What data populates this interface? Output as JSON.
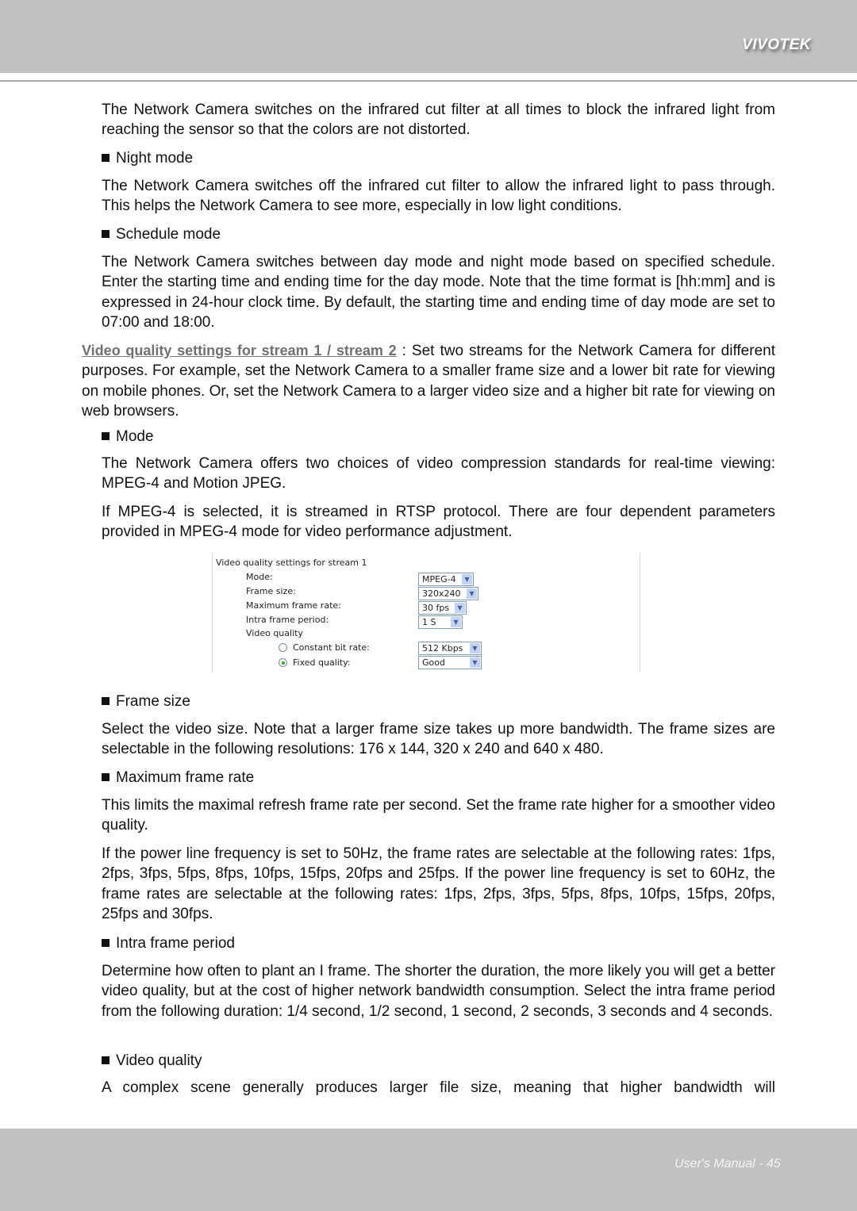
{
  "header": {
    "brand": "VIVOTEK"
  },
  "footer": {
    "page_label": "User's Manual - 45"
  },
  "content": {
    "p1": "The Network Camera switches on the infrared cut filter at all times to block the infrared light from reaching the sensor so that the colors are not distorted.",
    "b_night": "Night mode",
    "p2": "The Network Camera switches off the infrared cut filter to allow the infrared light to pass through. This helps the  Network Camera to see more, especially in low light conditions.",
    "b_schedule": "Schedule mode",
    "p3": "The Network Camera switches between day mode and night mode based on specified schedule. Enter the starting time and ending time for the day mode. Note that the time format is [hh:mm] and is expressed in 24-hour clock time. By default, the starting time and ending time of day mode are set to 07:00 and 18:00.",
    "link": "Video quality settings for stream 1 / stream 2",
    "p4_rest": " :  Set two streams for the Network Camera for different purposes. For example, set the Network Camera to a smaller frame size and a lower bit rate for viewing on mobile phones. Or, set the Network Camera to a larger video size and a higher bit rate for viewing on web browsers.",
    "b_mode": "Mode",
    "p5": "The Network Camera offers two choices of video compression standards for real-time viewing: MPEG-4 and Motion JPEG.",
    "p6": "If MPEG-4 is selected, it is streamed in RTSP protocol. There are four dependent parameters provided in MPEG-4 mode for video performance adjustment.",
    "b_frame": "Frame size",
    "p7": "Select the video size. Note that a larger frame size takes up more bandwidth. The frame sizes are selectable in the following resolutions: 176 x 144, 320 x 240 and 640 x 480.",
    "b_maxrate": "Maximum frame rate",
    "p8": "This limits the maximal refresh frame rate per second. Set the frame rate higher for a smoother video quality.",
    "p9": "If the power line frequency is set to 50Hz, the frame rates are selectable at the following rates: 1fps, 2fps, 3fps, 5fps, 8fps, 10fps, 15fps, 20fps and 25fps. If the power line frequency is set to 60Hz, the frame rates are selectable at the following rates: 1fps, 2fps, 3fps, 5fps, 8fps, 10fps, 15fps, 20fps, 25fps and 30fps.",
    "b_intra": "Intra frame period",
    "p10": "Determine how often to plant an I frame. The shorter the duration, the more likely you will get a better video quality, but at the cost of higher network bandwidth consumption. Select the intra frame period from the following duration: 1/4 second, 1/2 second, 1 second, 2 seconds, 3 seconds and 4 seconds.",
    "b_vq": "Video quality",
    "p11": "A complex scene generally produces larger file size, meaning that higher bandwidth will"
  },
  "screenshot": {
    "title": "Video quality settings for stream 1",
    "mode_label": "Mode:",
    "mode_value": "MPEG-4",
    "frame_size_label": "Frame size:",
    "frame_size_value": "320x240",
    "max_rate_label": "Maximum frame rate:",
    "max_rate_value": "30 fps",
    "intra_label": "Intra frame period:",
    "intra_value": "1 S",
    "vq_label": "Video quality",
    "cbr_label": "Constant bit rate:",
    "cbr_value": "512 Kbps",
    "cbr_selected": false,
    "fixed_label": "Fixed quality:",
    "fixed_value": "Good",
    "fixed_selected": true
  }
}
